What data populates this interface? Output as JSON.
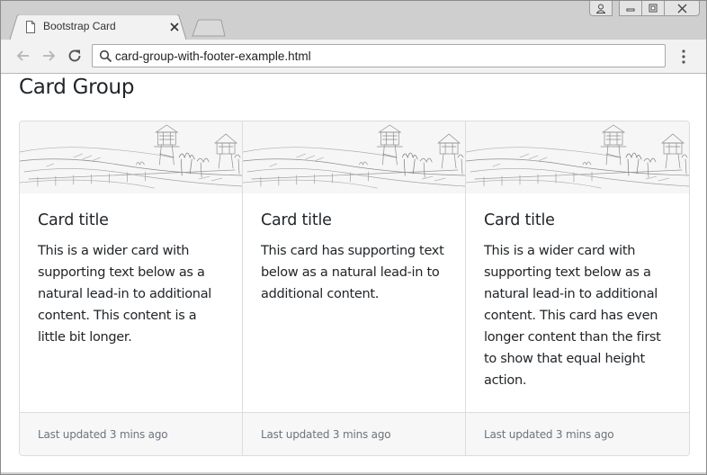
{
  "browser": {
    "tab_title": "Bootstrap Card",
    "address": "card-group-with-footer-example.html",
    "icons": {
      "tab": "file-icon",
      "close": "close-icon",
      "back": "arrow-left-icon",
      "forward": "arrow-right-icon",
      "reload": "reload-icon",
      "search": "search-icon",
      "menu": "kebab-menu-icon",
      "user": "user-icon",
      "minimize": "minimize-icon",
      "maximize": "maximize-icon",
      "window_close": "window-close-icon"
    }
  },
  "page": {
    "title": "Card Group"
  },
  "cards": [
    {
      "image": "sketch-landscape-image",
      "title": "Card title",
      "text": "This is a wider card with supporting text below as a natural lead-in to additional content. This content is a little bit longer.",
      "footer": "Last updated 3 mins ago"
    },
    {
      "image": "sketch-landscape-image",
      "title": "Card title",
      "text": "This card has supporting text below as a natural lead-in to additional content.",
      "footer": "Last updated 3 mins ago"
    },
    {
      "image": "sketch-landscape-image",
      "title": "Card title",
      "text": "This is a wider card with supporting text below as a natural lead-in to additional content. This card has even longer content than the first to show that equal height action.",
      "footer": "Last updated 3 mins ago"
    }
  ],
  "colors": {
    "text": "#212529",
    "muted": "#6c757d",
    "border": "#dcdcdc",
    "footer_bg": "#f7f7f7",
    "chrome_frame": "#cfcfcf",
    "toolbar_bg": "#f2f2f2"
  }
}
